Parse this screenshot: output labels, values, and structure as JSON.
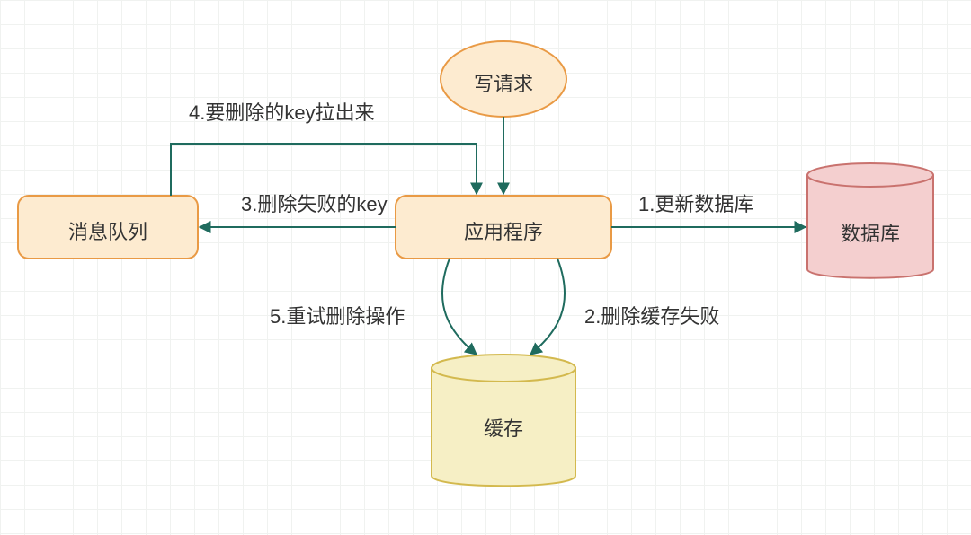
{
  "nodes": {
    "write_request": "写请求",
    "application": "应用程序",
    "message_queue": "消息队列",
    "database": "数据库",
    "cache": "缓存"
  },
  "edges": {
    "e1": "1.更新数据库",
    "e2": "2.删除缓存失败",
    "e3": "3.删除失败的key",
    "e4": "4.要删除的key拉出来",
    "e5": "5.重试删除操作"
  },
  "colors": {
    "orange_fill": "#fdebd0",
    "orange_stroke": "#e99a45",
    "yellow_fill": "#f6efc5",
    "yellow_stroke": "#d3b94e",
    "red_fill": "#f4cfcf",
    "red_stroke": "#c9726e",
    "line": "#1f6b5e"
  }
}
